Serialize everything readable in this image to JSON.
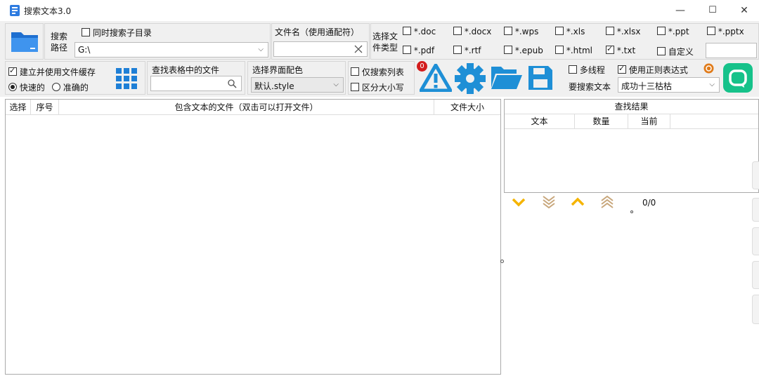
{
  "window": {
    "title": "搜索文本3.0",
    "minimize": "—",
    "maximize": "☐",
    "close": "✕"
  },
  "search_path": {
    "label_line1": "搜索",
    "label_line2": "路径",
    "subdir_label": "同时搜索子目录",
    "path_value": "G:\\",
    "dropdown_arrow": "⌵"
  },
  "filename": {
    "label": "文件名（使用通配符）",
    "value": ""
  },
  "file_types": {
    "label_line1": "选择文",
    "label_line2": "件类型",
    "items": [
      {
        "label": "*.doc",
        "checked": false
      },
      {
        "label": "*.docx",
        "checked": false
      },
      {
        "label": "*.wps",
        "checked": false
      },
      {
        "label": "*.xls",
        "checked": false
      },
      {
        "label": "*.xlsx",
        "checked": false
      },
      {
        "label": "*.ppt",
        "checked": false
      },
      {
        "label": "*.pptx",
        "checked": false
      },
      {
        "label": "*.pdf",
        "checked": false
      },
      {
        "label": "*.rtf",
        "checked": false
      },
      {
        "label": "*.epub",
        "checked": false
      },
      {
        "label": "*.html",
        "checked": false
      },
      {
        "label": "*.txt",
        "checked": true
      },
      {
        "label": "自定义",
        "checked": false
      }
    ],
    "custom_value": ""
  },
  "cache": {
    "label": "建立并使用文件缓存",
    "checked": true,
    "fast_label": "快速的",
    "accurate_label": "准确的"
  },
  "table_search": {
    "label": "查找表格中的文件",
    "value": ""
  },
  "style": {
    "label": "选择界面配色",
    "value": "默认.style"
  },
  "options": {
    "only_list": "仅搜索列表",
    "case_sensitive": "区分大小写",
    "multithread": "多线程",
    "regex": "使用正则表达式",
    "regex_checked": true
  },
  "toolbar": {
    "badge_count": "0"
  },
  "search_text": {
    "label": "要搜索文本",
    "value": "成功十三枯枯"
  },
  "file_table": {
    "columns": [
      "选择",
      "序号",
      "包含文本的文件（双击可以打开文件）",
      "文件大小"
    ]
  },
  "results": {
    "title": "查找结果",
    "columns": [
      "文本",
      "数量",
      "当前"
    ],
    "counter": "0/0"
  },
  "colors": {
    "accent_blue": "#1e8fd6",
    "nav_yellow": "#f5b400",
    "nav_tan": "#c8a77c",
    "green_chat": "#16c28a"
  }
}
